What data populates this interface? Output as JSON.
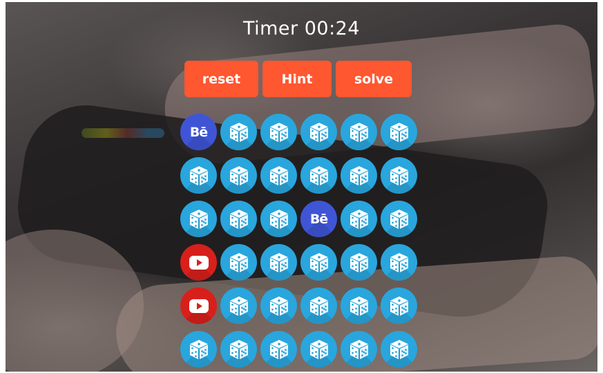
{
  "header": {
    "timer_text": "Timer 00:24"
  },
  "controls": {
    "reset_label": "reset",
    "hint_label": "Hint",
    "solve_label": "solve"
  },
  "board": {
    "columns": 6,
    "rows": 6,
    "tiles": [
      [
        "behance",
        "dice",
        "dice",
        "dice",
        "dice",
        "dice"
      ],
      [
        "dice",
        "dice",
        "dice",
        "dice",
        "dice",
        "dice"
      ],
      [
        "dice",
        "dice",
        "dice",
        "behance",
        "dice",
        "dice"
      ],
      [
        "youtube",
        "dice",
        "dice",
        "dice",
        "dice",
        "dice"
      ],
      [
        "youtube",
        "dice",
        "dice",
        "dice",
        "dice",
        "dice"
      ],
      [
        "dice",
        "dice",
        "dice",
        "dice",
        "dice",
        "dice"
      ]
    ],
    "behance_label": "Bē"
  },
  "colors": {
    "button": "#ff5730",
    "dice_tile": "#29a6dd",
    "behance_tile": "#3f55d6",
    "youtube_tile": "#d7201b",
    "text": "#ffffff"
  },
  "icons": {
    "dice": "dice-icon",
    "behance": "behance-icon",
    "youtube": "youtube-icon"
  }
}
